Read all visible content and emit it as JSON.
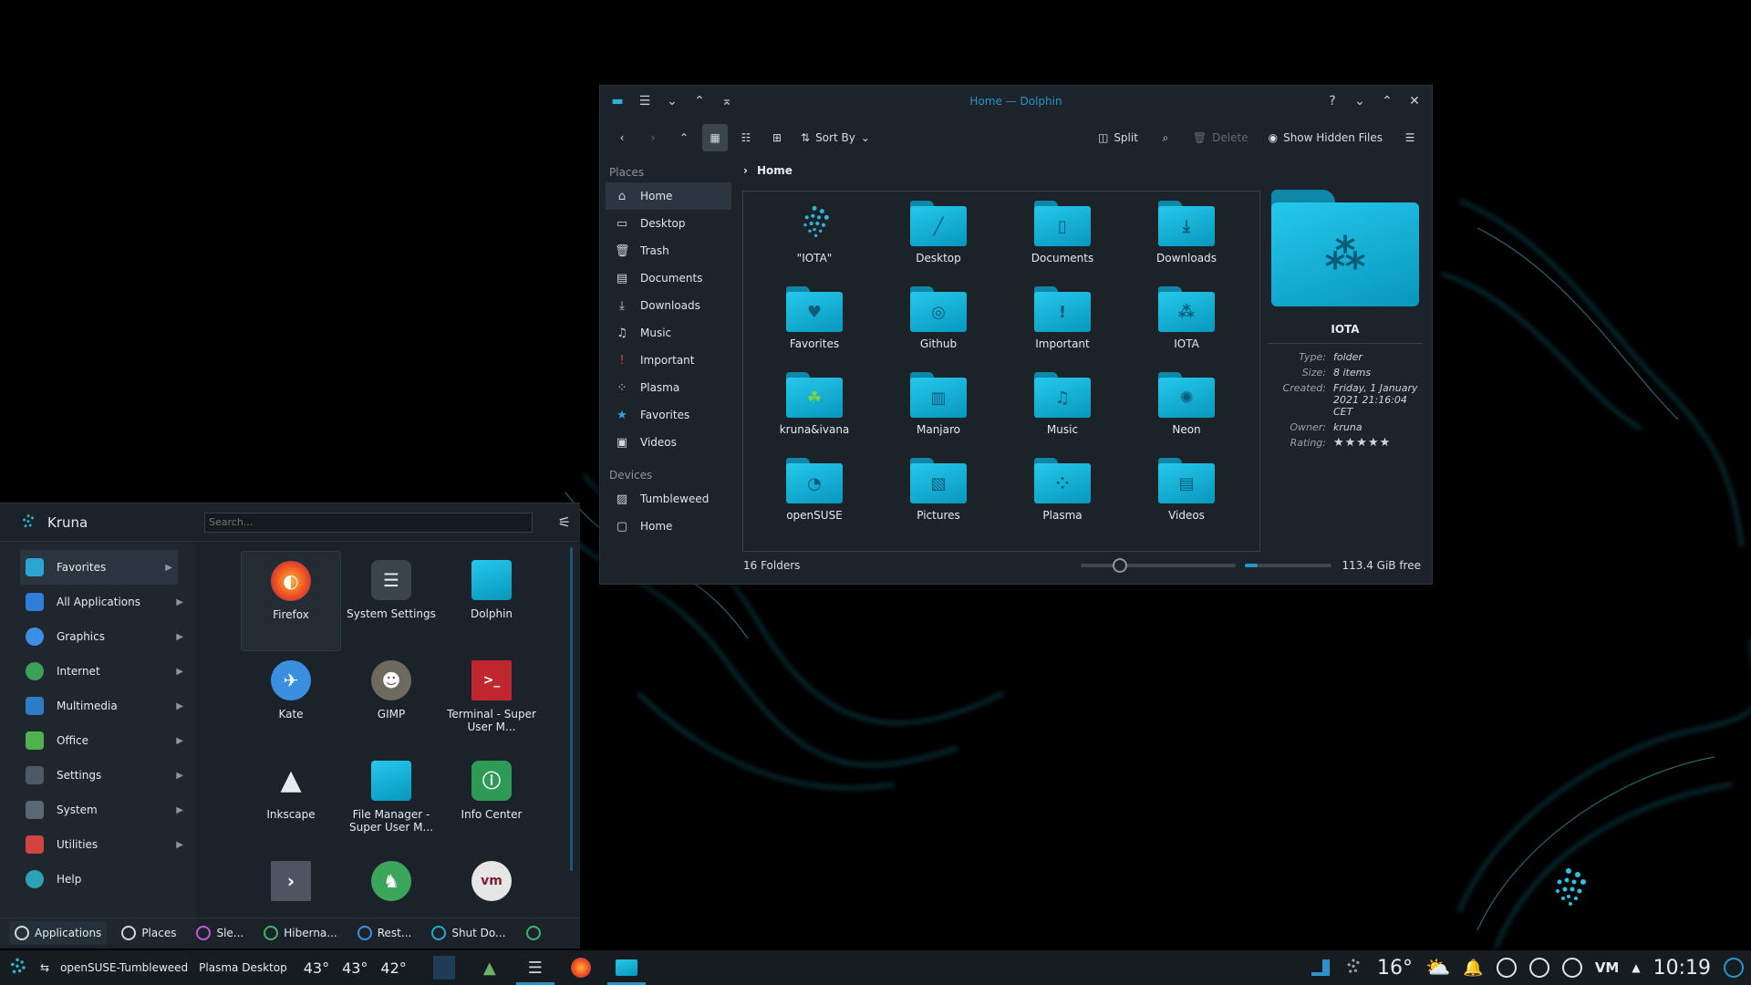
{
  "window": {
    "title": "Home — Dolphin",
    "toolbar": {
      "sort_label": "Sort By",
      "split_label": "Split",
      "delete_label": "Delete",
      "hidden_label": "Show Hidden Files"
    }
  },
  "sidebar": {
    "places_header": "Places",
    "places": [
      "Home",
      "Desktop",
      "Trash",
      "Documents",
      "Downloads",
      "Music",
      "Important",
      "Plasma",
      "Favorites",
      "Videos"
    ],
    "devices_header": "Devices",
    "devices": [
      "Tumbleweed",
      "Home"
    ]
  },
  "breadcrumb": {
    "current": "Home"
  },
  "files": [
    "\"IOTA\"",
    "Desktop",
    "Documents",
    "Downloads",
    "Favorites",
    "Github",
    "Important",
    "IOTA",
    "kruna&ivana",
    "Manjaro",
    "Music",
    "Neon",
    "openSUSE",
    "Pictures",
    "Plasma",
    "Videos"
  ],
  "status": {
    "count": "16 Folders",
    "free": "113.4 GiB free",
    "zoom_fraction": 0.25,
    "used_fraction": 0.15
  },
  "info": {
    "name": "IOTA",
    "rows": [
      {
        "k": "Type:",
        "v": "folder"
      },
      {
        "k": "Size:",
        "v": "8 items"
      },
      {
        "k": "Created:",
        "v": "Friday, 1 January 2021 21:16:04 CET"
      },
      {
        "k": "Owner:",
        "v": "kruna"
      },
      {
        "k": "Rating:",
        "v": ""
      }
    ],
    "rating": 5
  },
  "launcher": {
    "user": "Kruna",
    "search_placeholder": "Search...",
    "categories": [
      "Favorites",
      "All Applications",
      "Graphics",
      "Internet",
      "Multimedia",
      "Office",
      "Settings",
      "System",
      "Utilities",
      "Help"
    ],
    "apps": [
      "Firefox",
      "System Settings",
      "Dolphin",
      "Kate",
      "GIMP",
      "Terminal - Super User M...",
      "Inkscape",
      "File Manager - Super User M...",
      "Info Center",
      "",
      "",
      ""
    ],
    "footer": [
      "Applications",
      "Places",
      "Sle...",
      "Hiberna...",
      "Rest...",
      "Shut Do..."
    ]
  },
  "taskbar": {
    "distro": "openSUSE-Tumbleweed",
    "activity": "Plasma Desktop",
    "temps": [
      "43°",
      "43°",
      "42°"
    ],
    "weather": "16°",
    "clock": "10:19"
  }
}
